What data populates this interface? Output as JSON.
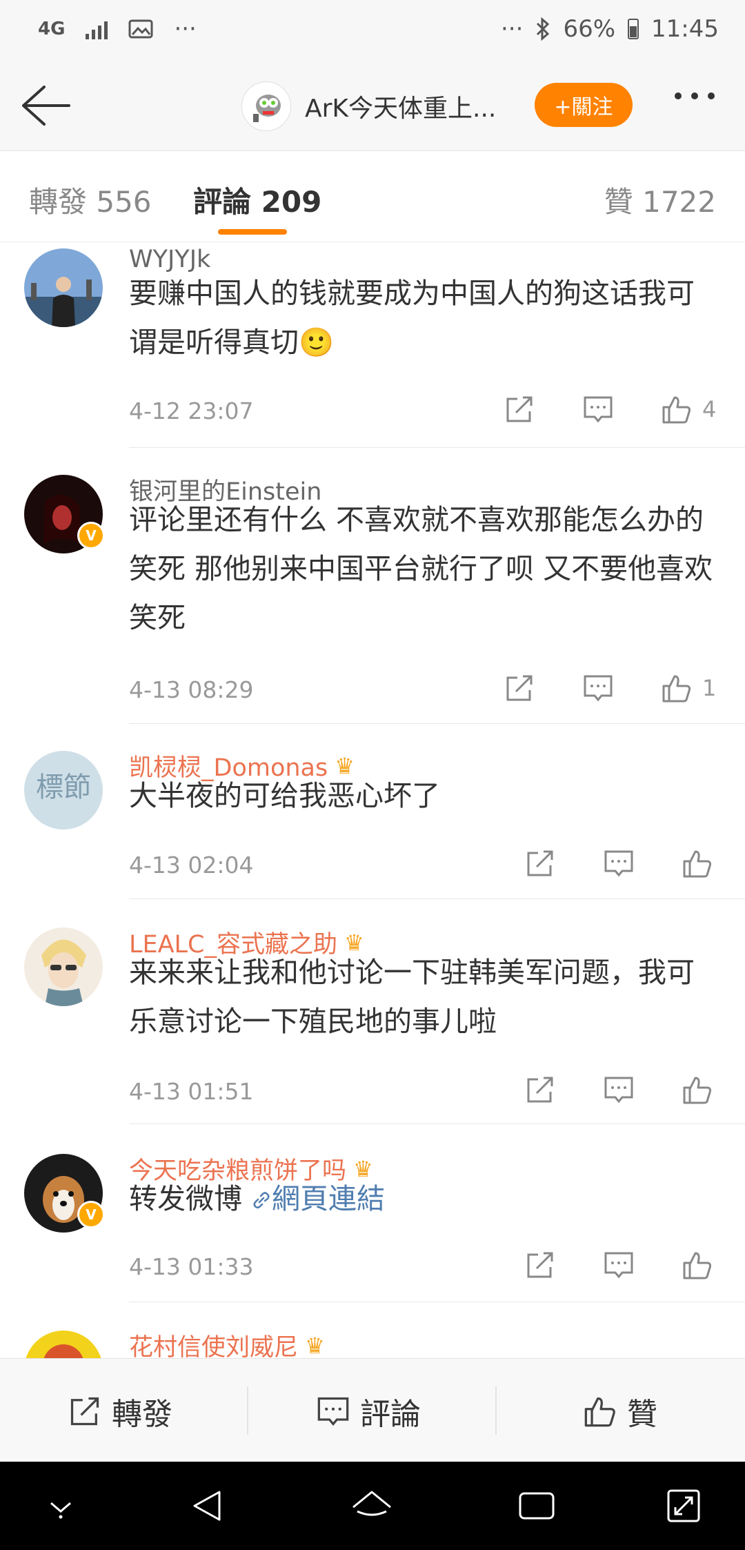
{
  "status_bar": {
    "network": "4G",
    "dots_left": "···",
    "dots_right": "···",
    "battery": "66%",
    "time": "11:45"
  },
  "header": {
    "title": "ArK今天体重上...",
    "follow_label": "+關注"
  },
  "tabs": {
    "repost": "轉發 556",
    "comment": "評論 209",
    "like": "贊 1722"
  },
  "comments": [
    {
      "user": "WYJYJk",
      "text": "要赚中国人的钱就要成为中国人的狗这话我可谓是听得真切🙂",
      "time": "4-12 23:07",
      "likes": "4"
    },
    {
      "user": "银河里的Einstein",
      "text": "评论里还有什么 不喜欢就不喜欢那能怎么办的 笑死 那他别来中国平台就行了呗 又不要他喜欢 笑死",
      "time": "4-13 08:29",
      "likes": "1"
    },
    {
      "user": "凯棂棂_Domonas",
      "text": "大半夜的可给我恶心坏了",
      "time": "4-13 02:04",
      "likes": ""
    },
    {
      "user": "LEALC_容式藏之助",
      "text": "来来来让我和他讨论一下驻韩美军问题，我可乐意讨论一下殖民地的事儿啦",
      "time": "4-13 01:51",
      "likes": ""
    },
    {
      "user": "今天吃杂粮煎饼了吗",
      "text": "转发微博",
      "link": "網頁連結",
      "time": "4-13 01:33",
      "likes": ""
    },
    {
      "user": "花村信使刘威尼"
    }
  ],
  "toolbar": {
    "repost": "轉發",
    "comment": "評論",
    "like": "贊"
  },
  "colors": {
    "accent": "#ff8200",
    "vip_name": "#eb7350",
    "link": "#507daf"
  }
}
